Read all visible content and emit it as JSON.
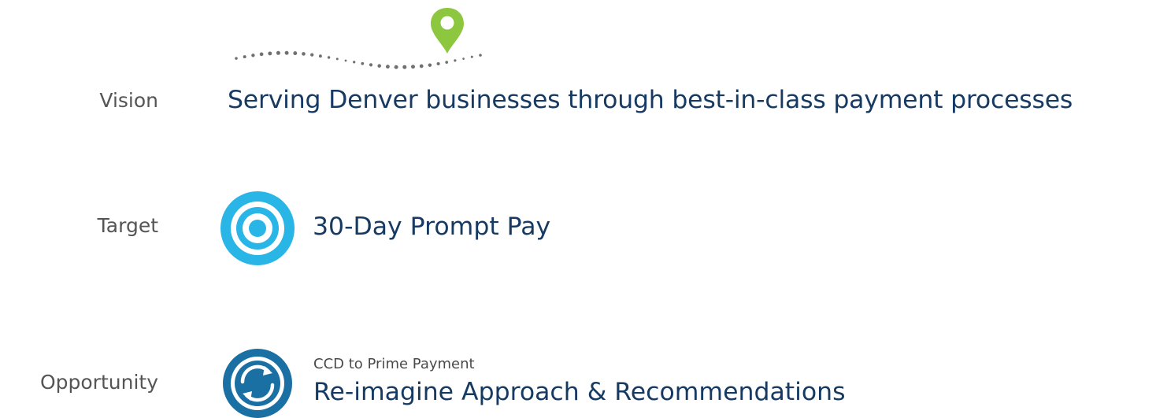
{
  "rows": {
    "vision": {
      "label": "Vision",
      "text": "Serving Denver businesses through best-in-class payment processes",
      "icon": "map-pin-path-icon"
    },
    "target": {
      "label": "Target",
      "text": "30-Day Prompt Pay",
      "icon": "target-icon"
    },
    "opportunity": {
      "label": "Opportunity",
      "subtitle": "CCD to Prime Payment",
      "text": "Re-imagine Approach & Recommendations",
      "icon": "refresh-cycle-icon"
    }
  },
  "colors": {
    "label_gray": "#555555",
    "heading_navy": "#173a63",
    "pin_green": "#8dc63f",
    "target_cyan": "#29b6e6",
    "cycle_blue": "#1a6fa3",
    "dot_gray": "#707070"
  }
}
